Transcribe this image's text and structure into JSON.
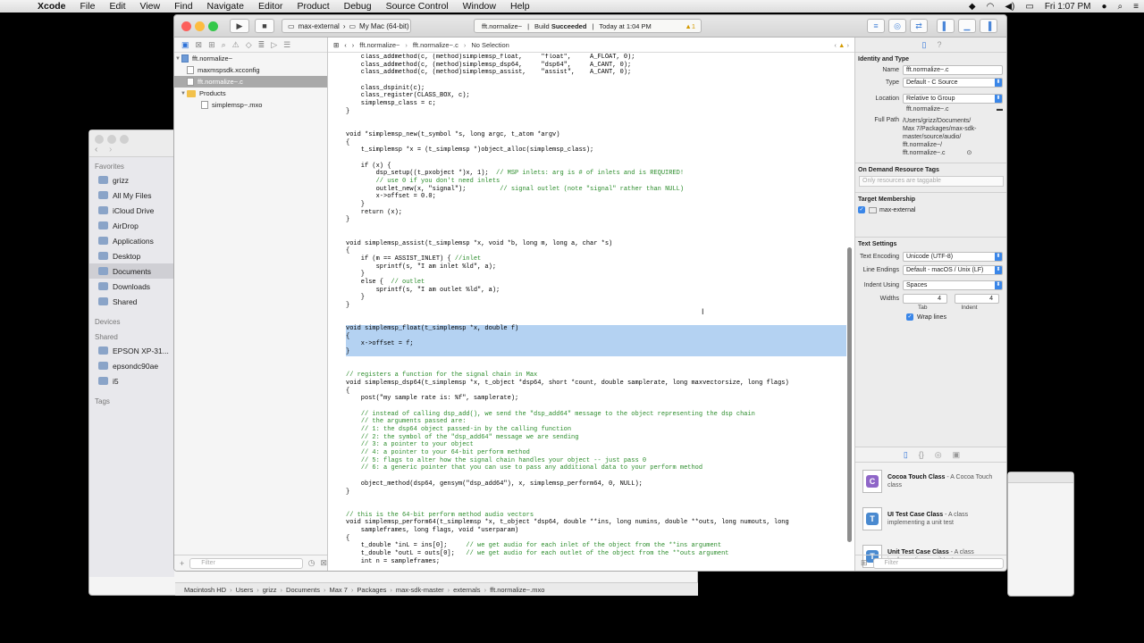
{
  "menubar": {
    "app": "Xcode",
    "items": [
      "File",
      "Edit",
      "View",
      "Find",
      "Navigate",
      "Editor",
      "Product",
      "Debug",
      "Source Control",
      "Window",
      "Help"
    ],
    "clock": "Fri 1:07 PM"
  },
  "toolbar": {
    "scheme_target": "max-external",
    "scheme_device": "My Mac (64-bit)",
    "activity_file": "fft.normalize~",
    "activity_status_label": "Build",
    "activity_status": "Succeeded",
    "activity_time": "Today at 1:04 PM",
    "warning_count": "1"
  },
  "navigator": {
    "project": "fft.normalize~",
    "files": [
      "maxmspsdk.xcconfig",
      "fft.normalize~.c"
    ],
    "group": "Products",
    "products": [
      "simplemsp~.mxo"
    ]
  },
  "jumpbar": {
    "crumb1": "fft.normalize~",
    "crumb2": "fft.normalize~.c",
    "crumb3": "No Selection"
  },
  "code_lines": [
    "    class_addmethod(c, (method)simplemsp_float,     \"float\",     A_FLOAT, 0);",
    "    class_addmethod(c, (method)simplemsp_dsp64,     \"dsp64\",     A_CANT, 0);",
    "    class_addmethod(c, (method)simplemsp_assist,    \"assist\",    A_CANT, 0);",
    "",
    "    class_dspinit(c);",
    "    class_register(CLASS_BOX, c);",
    "    simplemsp_class = c;",
    "}",
    "",
    "",
    "void *simplemsp_new(t_symbol *s, long argc, t_atom *argv)",
    "{",
    "    t_simplemsp *x = (t_simplemsp *)object_alloc(simplemsp_class);",
    "",
    "    if (x) {",
    "        dsp_setup((t_pxobject *)x, 1);  // MSP inlets: arg is # of inlets and is REQUIRED!",
    "        // use 0 if you don't need inlets",
    "        outlet_new(x, \"signal\");         // signal outlet (note \"signal\" rather than NULL)",
    "        x->offset = 0.0;",
    "    }",
    "    return (x);",
    "}",
    "",
    "",
    "void simplemsp_assist(t_simplemsp *x, void *b, long m, long a, char *s)",
    "{",
    "    if (m == ASSIST_INLET) { //inlet",
    "        sprintf(s, \"I am inlet %ld\", a);",
    "    }",
    "    else {  // outlet",
    "        sprintf(s, \"I am outlet %ld\", a);",
    "    }",
    "}",
    "",
    "",
    "void simplemsp_float(t_simplemsp *x, double f)",
    "{",
    "    x->offset = f;",
    "}",
    "",
    "",
    "// registers a function for the signal chain in Max",
    "void simplemsp_dsp64(t_simplemsp *x, t_object *dsp64, short *count, double samplerate, long maxvectorsize, long flags)",
    "{",
    "    post(\"my sample rate is: %f\", samplerate);",
    "",
    "    // instead of calling dsp_add(), we send the \"dsp_add64\" message to the object representing the dsp chain",
    "    // the arguments passed are:",
    "    // 1: the dsp64 object passed-in by the calling function",
    "    // 2: the symbol of the \"dsp_add64\" message we are sending",
    "    // 3: a pointer to your object",
    "    // 4: a pointer to your 64-bit perform method",
    "    // 5: flags to alter how the signal chain handles your object -- just pass 0",
    "    // 6: a generic pointer that you can use to pass any additional data to your perform method",
    "",
    "    object_method(dsp64, gensym(\"dsp_add64\"), x, simplemsp_perform64, 0, NULL);",
    "}",
    "",
    "",
    "// this is the 64-bit perform method audio vectors",
    "void simplemsp_perform64(t_simplemsp *x, t_object *dsp64, double **ins, long numins, double **outs, long numouts, long",
    "    sampleframes, long flags, void *userparam)",
    "{",
    "    t_double *inL = ins[0];     // we get audio for each inlet of the object from the **ins argument",
    "    t_double *outL = outs[0];   // we get audio for each outlet of the object from the **outs argument",
    "    int n = sampleframes;"
  ],
  "inspector": {
    "identity_title": "Identity and Type",
    "name_label": "Name",
    "name_value": "fft.normalize~.c",
    "type_label": "Type",
    "type_value": "Default - C Source",
    "location_label": "Location",
    "location_value": "Relative to Group",
    "location_file": "fft.normalize~.c",
    "fullpath_label": "Full Path",
    "fullpath_lines": [
      "/Users/grizz/Documents/",
      "Max 7/Packages/max-sdk-",
      "master/source/audio/",
      "fft.normalize~/",
      "fft.normalize~.c"
    ],
    "ondemand_title": "On Demand Resource Tags",
    "ondemand_placeholder": "Only resources are taggable",
    "target_title": "Target Membership",
    "target_name": "max-external",
    "text_title": "Text Settings",
    "encoding_label": "Text Encoding",
    "encoding_value": "Unicode (UTF-8)",
    "lineend_label": "Line Endings",
    "lineend_value": "Default - macOS / Unix (LF)",
    "indent_label": "Indent Using",
    "indent_value": "Spaces",
    "widths_label": "Widths",
    "tab_width": "4",
    "indent_width": "4",
    "tab_label": "Tab",
    "indent_sub_label": "Indent",
    "wrap_label": "Wrap lines"
  },
  "library": [
    {
      "title": "Cocoa Touch Class",
      "desc": " - A Cocoa Touch class",
      "color": "#8f66c8",
      "glyph": "C"
    },
    {
      "title": "UI Test Case Class",
      "desc": " - A class implementing a unit test",
      "color": "#4a8ad0",
      "glyph": "T"
    },
    {
      "title": "Unit Test Case Class",
      "desc": " - A class implementing a unit test",
      "color": "#4a8ad0",
      "glyph": "T"
    }
  ],
  "filter_placeholder": "Filter",
  "finder": {
    "favorites_title": "Favorites",
    "favorites": [
      "grizz",
      "All My Files",
      "iCloud Drive",
      "AirDrop",
      "Applications",
      "Desktop",
      "Documents",
      "Downloads",
      "Shared"
    ],
    "devices_title": "Devices",
    "shared_title": "Shared",
    "shared": [
      "EPSON XP-31...",
      "epsondc90ae",
      "i5"
    ],
    "tags_title": "Tags"
  },
  "pathbar": [
    "Macintosh HD",
    "Users",
    "grizz",
    "Documents",
    "Max 7",
    "Packages",
    "max-sdk-master",
    "externals",
    "fft.normalize~.mxo"
  ]
}
